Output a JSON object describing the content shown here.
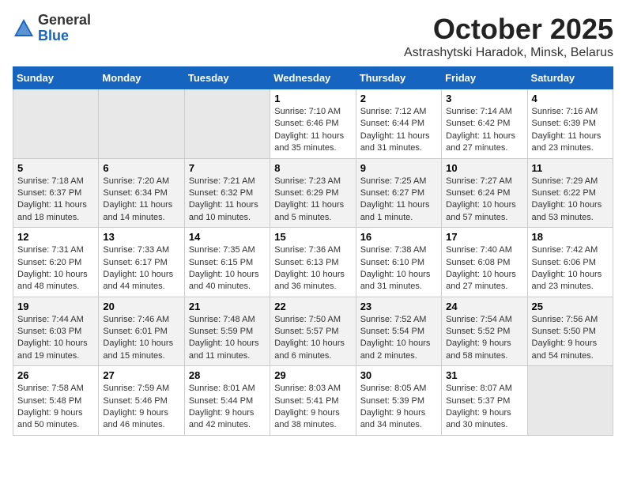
{
  "header": {
    "logo_general": "General",
    "logo_blue": "Blue",
    "month_title": "October 2025",
    "location": "Astrashytski Haradok, Minsk, Belarus"
  },
  "weekdays": [
    "Sunday",
    "Monday",
    "Tuesday",
    "Wednesday",
    "Thursday",
    "Friday",
    "Saturday"
  ],
  "weeks": [
    [
      {
        "day": "",
        "info": ""
      },
      {
        "day": "",
        "info": ""
      },
      {
        "day": "",
        "info": ""
      },
      {
        "day": "1",
        "info": "Sunrise: 7:10 AM\nSunset: 6:46 PM\nDaylight: 11 hours\nand 35 minutes."
      },
      {
        "day": "2",
        "info": "Sunrise: 7:12 AM\nSunset: 6:44 PM\nDaylight: 11 hours\nand 31 minutes."
      },
      {
        "day": "3",
        "info": "Sunrise: 7:14 AM\nSunset: 6:42 PM\nDaylight: 11 hours\nand 27 minutes."
      },
      {
        "day": "4",
        "info": "Sunrise: 7:16 AM\nSunset: 6:39 PM\nDaylight: 11 hours\nand 23 minutes."
      }
    ],
    [
      {
        "day": "5",
        "info": "Sunrise: 7:18 AM\nSunset: 6:37 PM\nDaylight: 11 hours\nand 18 minutes."
      },
      {
        "day": "6",
        "info": "Sunrise: 7:20 AM\nSunset: 6:34 PM\nDaylight: 11 hours\nand 14 minutes."
      },
      {
        "day": "7",
        "info": "Sunrise: 7:21 AM\nSunset: 6:32 PM\nDaylight: 11 hours\nand 10 minutes."
      },
      {
        "day": "8",
        "info": "Sunrise: 7:23 AM\nSunset: 6:29 PM\nDaylight: 11 hours\nand 5 minutes."
      },
      {
        "day": "9",
        "info": "Sunrise: 7:25 AM\nSunset: 6:27 PM\nDaylight: 11 hours\nand 1 minute."
      },
      {
        "day": "10",
        "info": "Sunrise: 7:27 AM\nSunset: 6:24 PM\nDaylight: 10 hours\nand 57 minutes."
      },
      {
        "day": "11",
        "info": "Sunrise: 7:29 AM\nSunset: 6:22 PM\nDaylight: 10 hours\nand 53 minutes."
      }
    ],
    [
      {
        "day": "12",
        "info": "Sunrise: 7:31 AM\nSunset: 6:20 PM\nDaylight: 10 hours\nand 48 minutes."
      },
      {
        "day": "13",
        "info": "Sunrise: 7:33 AM\nSunset: 6:17 PM\nDaylight: 10 hours\nand 44 minutes."
      },
      {
        "day": "14",
        "info": "Sunrise: 7:35 AM\nSunset: 6:15 PM\nDaylight: 10 hours\nand 40 minutes."
      },
      {
        "day": "15",
        "info": "Sunrise: 7:36 AM\nSunset: 6:13 PM\nDaylight: 10 hours\nand 36 minutes."
      },
      {
        "day": "16",
        "info": "Sunrise: 7:38 AM\nSunset: 6:10 PM\nDaylight: 10 hours\nand 31 minutes."
      },
      {
        "day": "17",
        "info": "Sunrise: 7:40 AM\nSunset: 6:08 PM\nDaylight: 10 hours\nand 27 minutes."
      },
      {
        "day": "18",
        "info": "Sunrise: 7:42 AM\nSunset: 6:06 PM\nDaylight: 10 hours\nand 23 minutes."
      }
    ],
    [
      {
        "day": "19",
        "info": "Sunrise: 7:44 AM\nSunset: 6:03 PM\nDaylight: 10 hours\nand 19 minutes."
      },
      {
        "day": "20",
        "info": "Sunrise: 7:46 AM\nSunset: 6:01 PM\nDaylight: 10 hours\nand 15 minutes."
      },
      {
        "day": "21",
        "info": "Sunrise: 7:48 AM\nSunset: 5:59 PM\nDaylight: 10 hours\nand 11 minutes."
      },
      {
        "day": "22",
        "info": "Sunrise: 7:50 AM\nSunset: 5:57 PM\nDaylight: 10 hours\nand 6 minutes."
      },
      {
        "day": "23",
        "info": "Sunrise: 7:52 AM\nSunset: 5:54 PM\nDaylight: 10 hours\nand 2 minutes."
      },
      {
        "day": "24",
        "info": "Sunrise: 7:54 AM\nSunset: 5:52 PM\nDaylight: 9 hours\nand 58 minutes."
      },
      {
        "day": "25",
        "info": "Sunrise: 7:56 AM\nSunset: 5:50 PM\nDaylight: 9 hours\nand 54 minutes."
      }
    ],
    [
      {
        "day": "26",
        "info": "Sunrise: 7:58 AM\nSunset: 5:48 PM\nDaylight: 9 hours\nand 50 minutes."
      },
      {
        "day": "27",
        "info": "Sunrise: 7:59 AM\nSunset: 5:46 PM\nDaylight: 9 hours\nand 46 minutes."
      },
      {
        "day": "28",
        "info": "Sunrise: 8:01 AM\nSunset: 5:44 PM\nDaylight: 9 hours\nand 42 minutes."
      },
      {
        "day": "29",
        "info": "Sunrise: 8:03 AM\nSunset: 5:41 PM\nDaylight: 9 hours\nand 38 minutes."
      },
      {
        "day": "30",
        "info": "Sunrise: 8:05 AM\nSunset: 5:39 PM\nDaylight: 9 hours\nand 34 minutes."
      },
      {
        "day": "31",
        "info": "Sunrise: 8:07 AM\nSunset: 5:37 PM\nDaylight: 9 hours\nand 30 minutes."
      },
      {
        "day": "",
        "info": ""
      }
    ]
  ]
}
